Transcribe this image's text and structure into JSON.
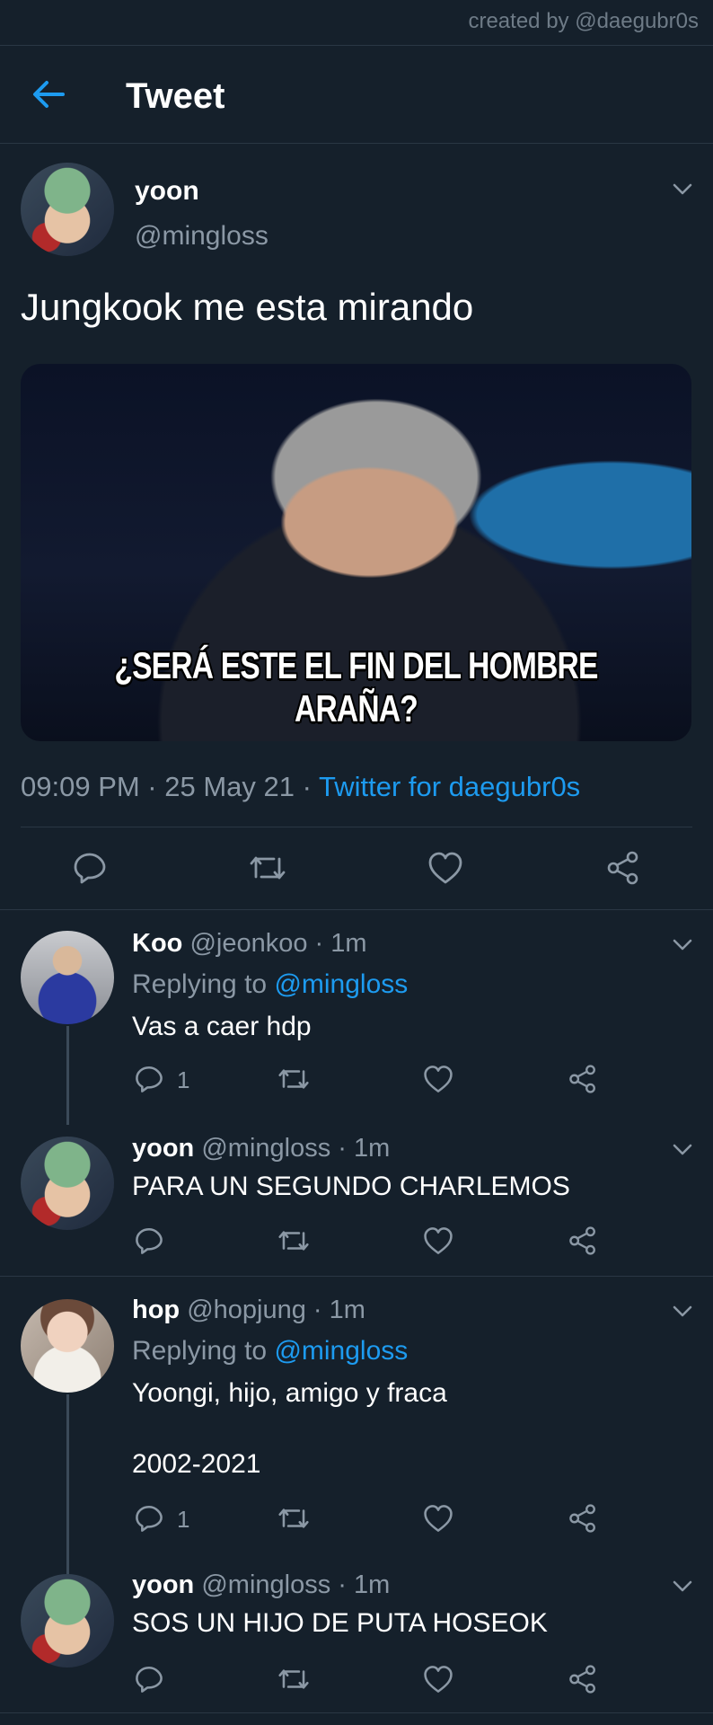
{
  "credit": "created by @daegubr0s",
  "header": {
    "title": "Tweet",
    "back_icon": "arrow-left-icon",
    "accent": "#1d9bf0"
  },
  "main_tweet": {
    "name": "yoon",
    "handle": "@mingloss",
    "text": "Jungkook me esta mirando",
    "image_caption": "¿SERÁ ESTE EL FIN DEL HOMBRE ARAÑA?",
    "time": "09:09 PM · 25 May 21 · ",
    "source": "Twitter for daegubr0s"
  },
  "replies": [
    {
      "name": "Koo",
      "meta": "@jeonkoo · 1m",
      "replying_label": "Replying to ",
      "replying_to": "@mingloss",
      "text": "Vas a caer hdp",
      "reply_count": "1"
    },
    {
      "name": "yoon",
      "meta": "@mingloss · 1m",
      "text": "PARA UN SEGUNDO CHARLEMOS"
    },
    {
      "name": "hop",
      "meta": "@hopjung · 1m",
      "replying_label": "Replying to ",
      "replying_to": "@mingloss",
      "text": "Yoongi, hijo, amigo y fraca",
      "text2": "2002-2021",
      "reply_count": "1"
    },
    {
      "name": "yoon",
      "meta": "@mingloss · 1m",
      "text": "SOS UN HIJO DE PUTA HOSEOK"
    }
  ],
  "colors": {
    "background": "#15202b",
    "muted": "#8b98a5",
    "link": "#1d9bf0",
    "divider": "#2a3744"
  }
}
